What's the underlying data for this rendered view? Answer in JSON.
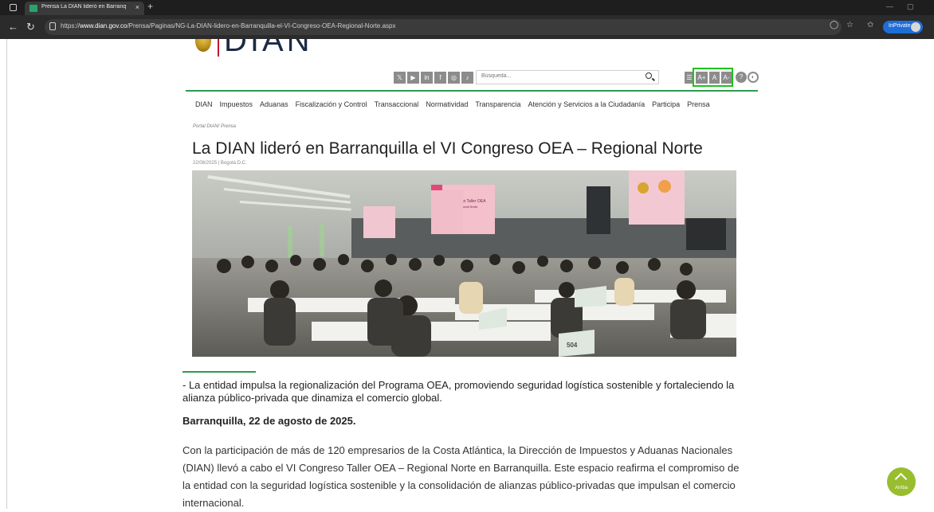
{
  "browser": {
    "tab_title": "Prensa La DIAN lideró en Barranq",
    "tab_close": "×",
    "new_tab": "+",
    "url_scheme": "https://",
    "url_host": "www.dian.gov.co",
    "url_path": "/Prensa/Paginas/NG-La-DIAN-lidero-en-Barranquilla-el-VI-Congreso-OEA-Regional-Norte.aspx",
    "inprivate_label": "InPrivate"
  },
  "site": {
    "logo_text": "DIAN",
    "social": [
      "𝕏",
      "▶",
      "in",
      "f",
      "◎",
      "♪"
    ],
    "search_placeholder": "Búsqueda...",
    "accessibility": {
      "increase": "A+",
      "normal": "A",
      "decrease": "A-",
      "help": "?",
      "contrast": "◐"
    },
    "nav": [
      "DIAN",
      "Impuestos",
      "Aduanas",
      "Fiscalización y Control",
      "Transaccional",
      "Normatividad",
      "Transparencia",
      "Atención y Servicios a la Ciudadanía",
      "Participa",
      "Prensa"
    ]
  },
  "article": {
    "breadcrumb": "Portal DIAN/  Prensa",
    "title": "La DIAN lideró en Barranquilla el VI Congreso OEA – Regional Norte",
    "dateline": "22/08/2025 | Bogotá D.C.",
    "lead": "- La entidad impulsa la regionalización del Programa OEA, promoviendo seguridad logística sostenible y fortaleciendo la alianza público-privada que dinamiza el comercio global.",
    "place_date": "Barranquilla, 22 de agosto de 2025.",
    "body": "Con la participación de más de 120 empresarios de la Costa Atlántica, la Dirección de Impuestos y Aduanas Nacionales (DIAN) llevó a cabo el VI Congreso Taller OEA – Regional Norte en Barranquilla. Este espacio reafirma el compromiso de la entidad con la seguridad logística sostenible y la consolidación de alianzas público-privadas que impulsan el comercio internacional."
  },
  "photo": {
    "banner_text": "Congreso Taller OEA",
    "banner_sub": "Regional Norte",
    "table_sign": "504"
  },
  "scroll_top_label": "Arriba",
  "colors": {
    "accent_green": "#2e9b4f",
    "highlight": "#1ec31e",
    "up_button": "#98bd2f"
  }
}
